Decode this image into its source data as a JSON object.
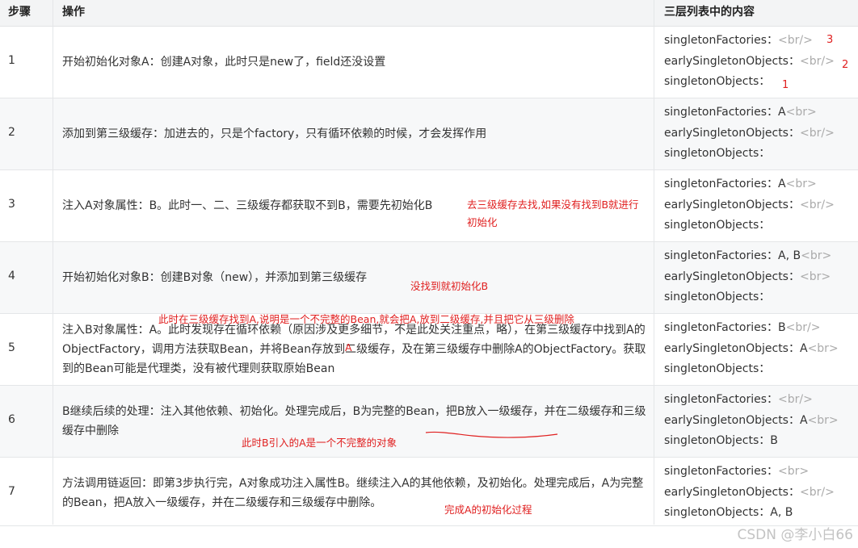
{
  "header": {
    "step": "步骤",
    "op": "操作",
    "layers": "三层列表中的内容"
  },
  "rows": [
    {
      "step": "1",
      "op": "开始初始化对象A：创建A对象，此时只是new了，field还没设置",
      "l1": "singletonFactories：",
      "l1br": "<br/>",
      "l2": "earlySingletonObjects：",
      "l2br": "<br/>",
      "l3": "singletonObjects：",
      "l3br": ""
    },
    {
      "step": "2",
      "op": "添加到第三级缓存：加进去的，只是个factory，只有循环依赖的时候，才会发挥作用",
      "l1": "singletonFactories：A",
      "l1br": "<br>",
      "l2": "earlySingletonObjects：",
      "l2br": "<br/>",
      "l3": "singletonObjects：",
      "l3br": ""
    },
    {
      "step": "3",
      "op": "注入A对象属性：B。此时一、二、三级缓存都获取不到B，需要先初始化B",
      "l1": "singletonFactories：A",
      "l1br": "<br>",
      "l2": "earlySingletonObjects：",
      "l2br": "<br/>",
      "l3": "singletonObjects：",
      "l3br": ""
    },
    {
      "step": "4",
      "op": "开始初始化对象B：创建B对象（new），并添加到第三级缓存",
      "l1": "singletonFactories：A, B",
      "l1br": "<br>",
      "l2": "earlySingletonObjects：",
      "l2br": "<br>",
      "l3": "singletonObjects：",
      "l3br": ""
    },
    {
      "step": "5",
      "op": "注入B对象属性：A。此时发现存在循环依赖（原因涉及更多细节，不是此处关注重点，略），在第三级缓存中找到A的ObjectFactory，调用方法获取Bean，并将Bean存放到二级缓存，及在第三级缓存中删除A的ObjectFactory。获取到的Bean可能是代理类，没有被代理则获取原始Bean",
      "l1": "singletonFactories：B",
      "l1br": "<br/>",
      "l2": "earlySingletonObjects：A",
      "l2br": "<br>",
      "l3": "singletonObjects：",
      "l3br": ""
    },
    {
      "step": "6",
      "op": "B继续后续的处理：注入其他依赖、初始化。处理完成后，B为完整的Bean，把B放入一级缓存，并在二级缓存和三级缓存中删除",
      "l1": "singletonFactories：",
      "l1br": "<br/>",
      "l2": "earlySingletonObjects：A",
      "l2br": "<br>",
      "l3": "singletonObjects：B",
      "l3br": ""
    },
    {
      "step": "7",
      "op": "方法调用链返回：即第3步执行完，A对象成功注入属性B。继续注入A的其他依赖，及初始化。处理完成后，A为完整的Bean，把A放入一级缓存，并在二级缓存和三级缓存中删除。",
      "l1": "singletonFactories：",
      "l1br": "<br>",
      "l2": "earlySingletonObjects：",
      "l2br": "<br/>",
      "l3": "singletonObjects：A, B",
      "l3br": ""
    }
  ],
  "annotations": {
    "a3": "去三级缓存去找,如果没有找到B就进行初始化",
    "a4": "没找到就初始化B",
    "a5": "此时在三级缓存找到A,说明是一个不完整的Bean,就会把A,放到二级缓存,并且把它从三级删除",
    "a5b": "A",
    "a6": "此时B引入的A是一个不完整的对象",
    "a7": "完成A的初始化过程",
    "n1": "3",
    "n2": "2",
    "n3": "1"
  },
  "watermark": "CSDN @李小白66"
}
